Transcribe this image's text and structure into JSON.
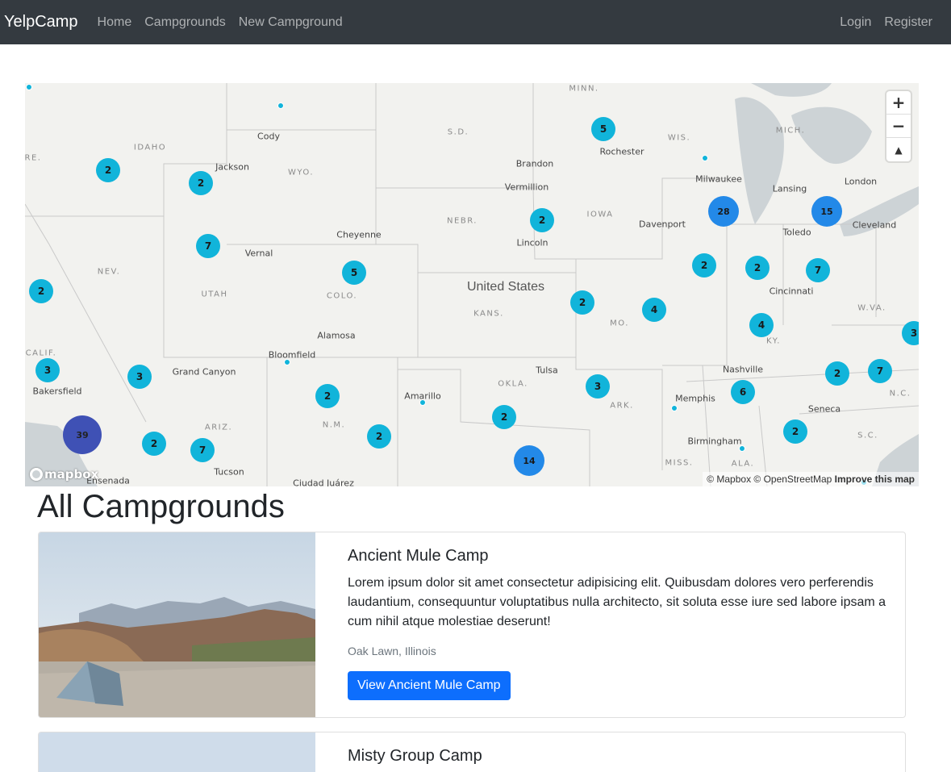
{
  "navbar": {
    "brand": "YelpCamp",
    "links": [
      "Home",
      "Campgrounds",
      "New Campground"
    ],
    "right_links": [
      "Login",
      "Register"
    ]
  },
  "map": {
    "country_label": "United States",
    "state_labels": [
      "IDAHO",
      "WYO.",
      "NEBR.",
      "IOWA",
      "NEV.",
      "UTAH",
      "COLO.",
      "KANS.",
      "MO.",
      "CALIF.",
      "OKLA.",
      "ARK.",
      "ARIZ.",
      "N.M.",
      "MISS.",
      "ALA.",
      "KY.",
      "W.VA.",
      "N.C.",
      "S.C.",
      "WIS.",
      "MICH.",
      "S.D.",
      "MINN.",
      "RE."
    ],
    "city_labels": [
      "Cody",
      "Jackson",
      "Brandon",
      "Vermillion",
      "Rochester",
      "Milwaukee",
      "Lansing",
      "London",
      "Davenport",
      "Toledo",
      "Cleveland",
      "Cheyenne",
      "Lincoln",
      "Vernal",
      "Cincinnati",
      "Alamosa",
      "Bloomfield",
      "Grand Canyon",
      "Tulsa",
      "Nashville",
      "Bakersfield",
      "Amarillo",
      "Memphis",
      "Seneca",
      "Birmingham",
      "Tucson",
      "Ciudad Juárez",
      "Ensenada"
    ],
    "clusters": [
      {
        "count": "2",
        "color": "#11b4da"
      },
      {
        "count": "2",
        "color": "#11b4da"
      },
      {
        "count": "5",
        "color": "#11b4da"
      },
      {
        "count": "28",
        "color": "#2389e8"
      },
      {
        "count": "15",
        "color": "#2389e8"
      },
      {
        "count": "2",
        "color": "#11b4da"
      },
      {
        "count": "7",
        "color": "#11b4da"
      },
      {
        "count": "5",
        "color": "#11b4da"
      },
      {
        "count": "2",
        "color": "#11b4da"
      },
      {
        "count": "2",
        "color": "#11b4da"
      },
      {
        "count": "2",
        "color": "#11b4da"
      },
      {
        "count": "7",
        "color": "#11b4da"
      },
      {
        "count": "2",
        "color": "#11b4da"
      },
      {
        "count": "4",
        "color": "#11b4da"
      },
      {
        "count": "4",
        "color": "#11b4da"
      },
      {
        "count": "3",
        "color": "#11b4da"
      },
      {
        "count": "3",
        "color": "#11b4da"
      },
      {
        "count": "3",
        "color": "#11b4da"
      },
      {
        "count": "2",
        "color": "#11b4da"
      },
      {
        "count": "3",
        "color": "#11b4da"
      },
      {
        "count": "6",
        "color": "#11b4da"
      },
      {
        "count": "2",
        "color": "#11b4da"
      },
      {
        "count": "7",
        "color": "#11b4da"
      },
      {
        "count": "39",
        "color": "#3f51b5"
      },
      {
        "count": "2",
        "color": "#11b4da"
      },
      {
        "count": "7",
        "color": "#11b4da"
      },
      {
        "count": "2",
        "color": "#11b4da"
      },
      {
        "count": "2",
        "color": "#11b4da"
      },
      {
        "count": "14",
        "color": "#2389e8"
      },
      {
        "count": "2",
        "color": "#11b4da"
      }
    ],
    "zoom_in": "+",
    "zoom_out": "−",
    "compass": "▲",
    "logo_text": "mapbox",
    "attribution": "© Mapbox © OpenStreetMap",
    "improve_link": "Improve this map"
  },
  "page_title": "All Campgrounds",
  "campgrounds": [
    {
      "title": "Ancient Mule Camp",
      "description": "Lorem ipsum dolor sit amet consectetur adipisicing elit. Quibusdam dolores vero perferendis laudantium, consequuntur voluptatibus nulla architecto, sit soluta esse iure sed labore ipsam a cum nihil atque molestiae deserunt!",
      "location": "Oak Lawn, Illinois",
      "button": "View Ancient Mule Camp"
    },
    {
      "title": "Misty Group Camp"
    }
  ]
}
